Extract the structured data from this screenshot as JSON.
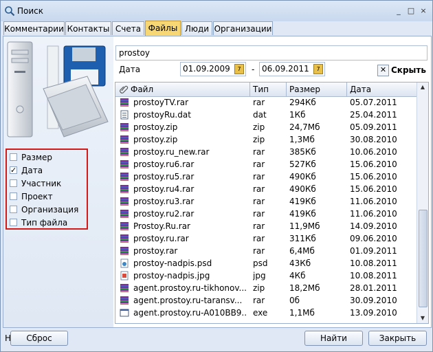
{
  "window": {
    "title": "Поиск",
    "stub_label": "Н"
  },
  "tabs": [
    "Комментарии",
    "Контакты",
    "Счета",
    "Файлы",
    "Люди",
    "Организации"
  ],
  "active_tab": "Файлы",
  "search": {
    "value": "prostoy"
  },
  "date_filter": {
    "label": "Дата",
    "from": "01.09.2009",
    "separator": "-",
    "to": "06.09.2011",
    "clear_label": "Скрыть"
  },
  "filters": [
    {
      "label": "Размер",
      "checked": false
    },
    {
      "label": "Дата",
      "checked": true
    },
    {
      "label": "Участник",
      "checked": false
    },
    {
      "label": "Проект",
      "checked": false
    },
    {
      "label": "Организация",
      "checked": false
    },
    {
      "label": "Тип файла",
      "checked": false
    }
  ],
  "columns": {
    "name": "Файл",
    "type": "Тип",
    "size": "Размер",
    "date": "Дата"
  },
  "files": [
    {
      "name": "prostoyTV.rar",
      "type": "rar",
      "size": "294Кб",
      "date": "05.07.2011",
      "icon": "rar"
    },
    {
      "name": "prostoyRu.dat",
      "type": "dat",
      "size": "1Кб",
      "date": "25.04.2011",
      "icon": "dat"
    },
    {
      "name": "prostoy.zip",
      "type": "zip",
      "size": "24,7Мб",
      "date": "05.09.2011",
      "icon": "rar"
    },
    {
      "name": "prostoy.zip",
      "type": "zip",
      "size": "1,3Мб",
      "date": "30.08.2010",
      "icon": "rar"
    },
    {
      "name": "prostoy.ru_new.rar",
      "type": "rar",
      "size": "385Кб",
      "date": "10.06.2010",
      "icon": "rar"
    },
    {
      "name": "prostoy.ru6.rar",
      "type": "rar",
      "size": "527Кб",
      "date": "15.06.2010",
      "icon": "rar"
    },
    {
      "name": "prostoy.ru5.rar",
      "type": "rar",
      "size": "490Кб",
      "date": "15.06.2010",
      "icon": "rar"
    },
    {
      "name": "prostoy.ru4.rar",
      "type": "rar",
      "size": "490Кб",
      "date": "15.06.2010",
      "icon": "rar"
    },
    {
      "name": "prostoy.ru3.rar",
      "type": "rar",
      "size": "419Кб",
      "date": "11.06.2010",
      "icon": "rar"
    },
    {
      "name": "prostoy.ru2.rar",
      "type": "rar",
      "size": "419Кб",
      "date": "11.06.2010",
      "icon": "rar"
    },
    {
      "name": "Prostoy.Ru.rar",
      "type": "rar",
      "size": "11,9Мб",
      "date": "14.09.2010",
      "icon": "rar"
    },
    {
      "name": "prostoy.ru.rar",
      "type": "rar",
      "size": "311Кб",
      "date": "09.06.2010",
      "icon": "rar"
    },
    {
      "name": "prostoy.rar",
      "type": "rar",
      "size": "6,4Мб",
      "date": "01.09.2011",
      "icon": "rar"
    },
    {
      "name": "prostoy-nadpis.psd",
      "type": "psd",
      "size": "43Кб",
      "date": "10.08.2011",
      "icon": "psd"
    },
    {
      "name": "prostoy-nadpis.jpg",
      "type": "jpg",
      "size": "4Кб",
      "date": "10.08.2011",
      "icon": "jpg"
    },
    {
      "name": "agent.prostoy.ru-tikhonov...",
      "type": "zip",
      "size": "18,2Мб",
      "date": "28.01.2011",
      "icon": "rar"
    },
    {
      "name": "agent.prostoy.ru-taransv...",
      "type": "rar",
      "size": "0б",
      "date": "30.09.2010",
      "icon": "rar"
    },
    {
      "name": "agent.prostoy.ru-A010BB9...",
      "type": "exe",
      "size": "1,1Мб",
      "date": "13.09.2010",
      "icon": "exe"
    }
  ],
  "buttons": {
    "reset": "Сброс",
    "find": "Найти",
    "close": "Закрыть"
  },
  "colors": {
    "active_tab": "#f7d774",
    "filter_highlight": "#d01a1a"
  }
}
